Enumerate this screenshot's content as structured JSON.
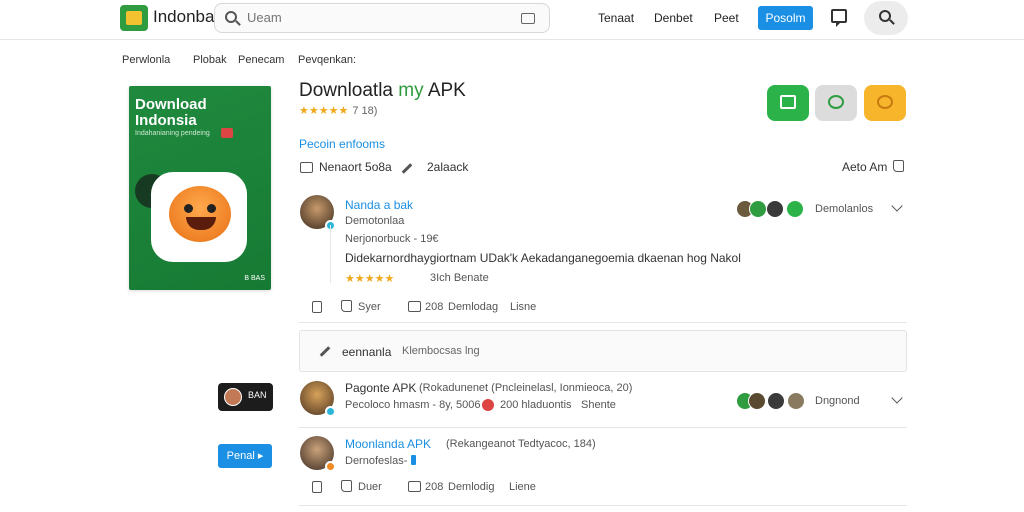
{
  "header": {
    "brand": "Indonbak",
    "search_placeholder": "Ueam",
    "nav": [
      "Tenaat",
      "Denbet",
      "Peet"
    ],
    "cta_label": "Posolm"
  },
  "breadcrumb": [
    "Perwlonla",
    "Plobak",
    "Penecam",
    "Pevqenkan:"
  ],
  "poster": {
    "title_line1": "Download",
    "title_line2": "Indonsia",
    "tagline": "Indahanianing pendeing",
    "footer": "B BAS"
  },
  "app": {
    "title_prefix": "Downloatla ",
    "title_accent": "my",
    "title_suffix": " APK",
    "stars": "★★★★★",
    "rating_count": "7 18)",
    "sublink": "Pecoin enfooms",
    "meta_left": "Nenaort 5o8a",
    "meta_mid": "2alaack",
    "meta_right": "Aeto Am"
  },
  "comment1": {
    "name": "Nanda a bak",
    "subtitle": "Demotonlaa",
    "meta": "Nerjonorbuck - 19€",
    "body": "Didekarnordhaygiortnam UDak'k Aekadanganegoemia dkaenan hog Nakol",
    "stars": "★★★★★",
    "rating_text": "3Ich Benate",
    "reply_label": "Syer",
    "stat": "208",
    "reply_link": "Demlodag",
    "share_link": "Lisne",
    "followers_label": "Demolanlos"
  },
  "compose": {
    "label": "eennanla",
    "placeholder": "Klembocsas lng"
  },
  "comment2": {
    "name": "Pagonte APK",
    "name_extra": "(Rokadunenet (Pncleinelasl, Ionmieoca, 20)",
    "meta": "Pecoloco hmasm - 8y, 5006",
    "stat": "200 hladuontis",
    "share_link": "Shente",
    "followers_label": "Dngnond"
  },
  "comment3": {
    "name": "Moonlanda APK",
    "name_extra": "(Rekangeanot Tedtyacoc, 184)",
    "subtitle": "Dernofeslas-",
    "reply_label": "Duer",
    "stat": "208",
    "reply_link": "Demlodig",
    "share_link": "Liene"
  },
  "side": {
    "thumb_label": "BAN",
    "button_label": "Penal ▸"
  },
  "colors": {
    "accent_blue": "#1a8fe3",
    "accent_green": "#2e9c3f",
    "star": "#f0a81c"
  }
}
